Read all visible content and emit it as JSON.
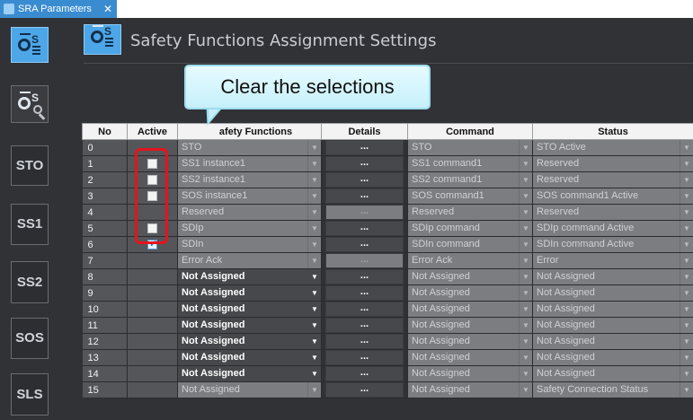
{
  "tab": {
    "label": "SRA Parameters",
    "close": "✕"
  },
  "header": {
    "title": "Safety Functions Assignment Settings"
  },
  "sidebar": {
    "buttons": [
      {
        "label": "STO"
      },
      {
        "label": "SS1"
      },
      {
        "label": "SS2"
      },
      {
        "label": "SOS"
      },
      {
        "label": "SLS"
      }
    ]
  },
  "callout": {
    "text": "Clear the selections"
  },
  "table": {
    "columns": [
      "No",
      "Active",
      "Safety Functions",
      "Details",
      "Command",
      "Status"
    ],
    "visible_header_fragment": "afety Functions",
    "details_label": "...",
    "rows": [
      {
        "no": "0",
        "active": null,
        "func": "STO",
        "func_enabled": false,
        "details_enabled": true,
        "command": "STO",
        "status": "STO Active"
      },
      {
        "no": "1",
        "active": false,
        "func": "SS1 instance1",
        "func_enabled": false,
        "details_enabled": true,
        "command": "SS1 command1",
        "status": "Reserved"
      },
      {
        "no": "2",
        "active": false,
        "func": "SS2 instance1",
        "func_enabled": false,
        "details_enabled": true,
        "command": "SS2 command1",
        "status": "Reserved"
      },
      {
        "no": "3",
        "active": false,
        "func": "SOS instance1",
        "func_enabled": false,
        "details_enabled": true,
        "command": "SOS command1",
        "status": "SOS command1 Active"
      },
      {
        "no": "4",
        "active": null,
        "func": "Reserved",
        "func_enabled": false,
        "details_enabled": false,
        "command": "Reserved",
        "status": "Reserved"
      },
      {
        "no": "5",
        "active": false,
        "func": "SDIp",
        "func_enabled": false,
        "details_enabled": true,
        "command": "SDIp command",
        "status": "SDIp command Active"
      },
      {
        "no": "6",
        "active": true,
        "func": "SDIn",
        "func_enabled": false,
        "details_enabled": true,
        "command": "SDIn command",
        "status": "SDIn command Active"
      },
      {
        "no": "7",
        "active": null,
        "func": "Error Ack",
        "func_enabled": false,
        "details_enabled": false,
        "command": "Error Ack",
        "status": "Error"
      },
      {
        "no": "8",
        "active": null,
        "func": "Not Assigned",
        "func_enabled": true,
        "details_enabled": true,
        "command": "Not Assigned",
        "status": "Not Assigned"
      },
      {
        "no": "9",
        "active": null,
        "func": "Not Assigned",
        "func_enabled": true,
        "details_enabled": true,
        "command": "Not Assigned",
        "status": "Not Assigned"
      },
      {
        "no": "10",
        "active": null,
        "func": "Not Assigned",
        "func_enabled": true,
        "details_enabled": true,
        "command": "Not Assigned",
        "status": "Not Assigned"
      },
      {
        "no": "11",
        "active": null,
        "func": "Not Assigned",
        "func_enabled": true,
        "details_enabled": true,
        "command": "Not Assigned",
        "status": "Not Assigned"
      },
      {
        "no": "12",
        "active": null,
        "func": "Not Assigned",
        "func_enabled": true,
        "details_enabled": true,
        "command": "Not Assigned",
        "status": "Not Assigned"
      },
      {
        "no": "13",
        "active": null,
        "func": "Not Assigned",
        "func_enabled": true,
        "details_enabled": true,
        "command": "Not Assigned",
        "status": "Not Assigned"
      },
      {
        "no": "14",
        "active": null,
        "func": "Not Assigned",
        "func_enabled": true,
        "details_enabled": true,
        "command": "Not Assigned",
        "status": "Not Assigned"
      },
      {
        "no": "15",
        "active": null,
        "func": "Not Assigned",
        "func_enabled": false,
        "details_enabled": true,
        "command": "Not Assigned",
        "status": "Safety Connection Status"
      }
    ]
  },
  "colors": {
    "accent": "#4da6e8",
    "highlight": "#e5141c",
    "background": "#303236"
  }
}
